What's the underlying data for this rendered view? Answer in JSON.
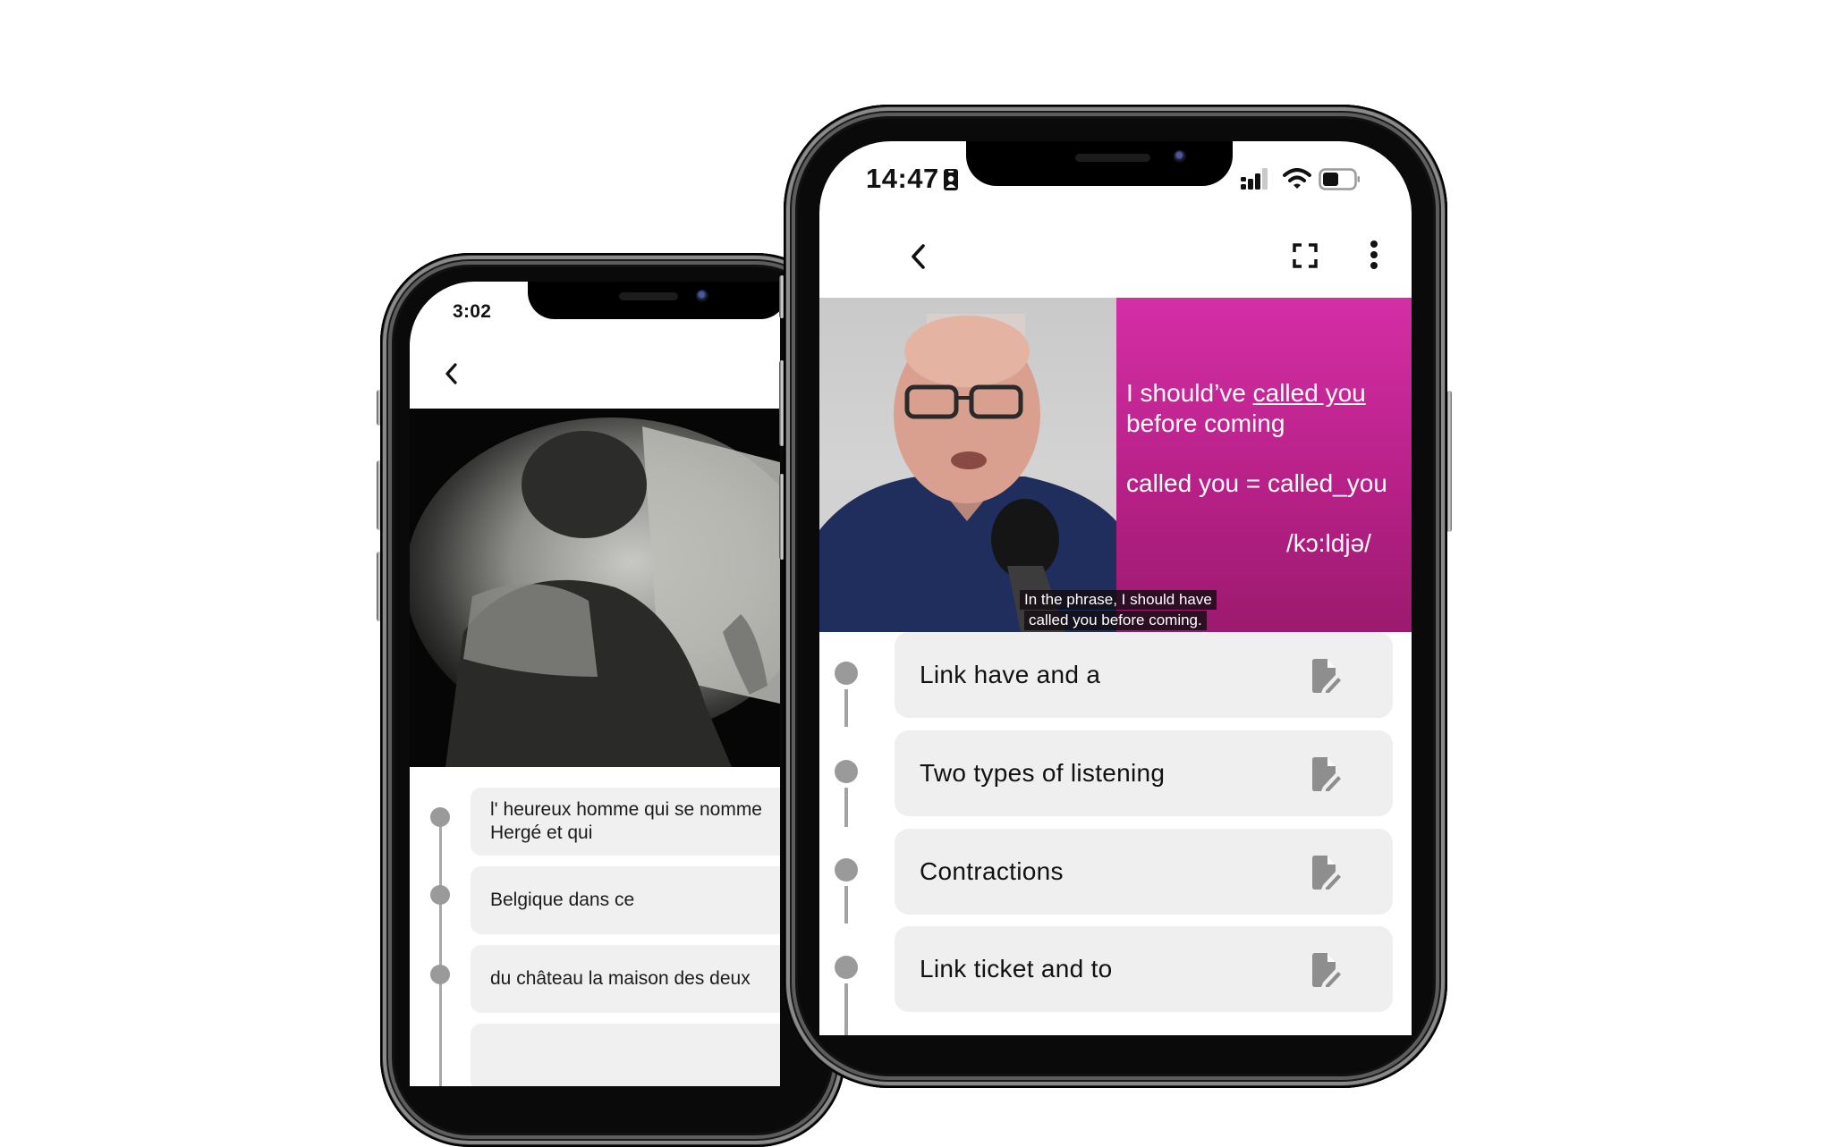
{
  "left_phone": {
    "status_bar": {
      "time": "3:02"
    },
    "nav": {
      "back_icon": "chevron-left-icon"
    },
    "video": {
      "description": "black-and-white film of a man drawing at a desk"
    },
    "timeline": [
      {
        "text": "l' heureux homme qui se nomme Hergé et qui"
      },
      {
        "text": "Belgique dans ce"
      },
      {
        "text": "du château la maison des deux"
      },
      {
        "text": ""
      }
    ],
    "colors": {
      "card_bg": "#f0f0f0",
      "dot": "#9a9a9a"
    }
  },
  "right_phone": {
    "status_bar": {
      "time": "14:47",
      "badge_icon": "person-badge-icon",
      "signal_icon": "cellular-signal-icon",
      "wifi_icon": "wifi-icon",
      "battery_icon": "battery-icon",
      "battery_level": 0.45
    },
    "nav": {
      "back_icon": "chevron-left-icon",
      "fullscreen_icon": "fullscreen-icon",
      "more_icon": "more-vertical-icon"
    },
    "video": {
      "slide": {
        "line1_prefix": "I should’ve ",
        "line1_underlined": "called you",
        "line2": "before coming",
        "line3": "called you = called_you",
        "line4": "/kɔ:ldjə/"
      },
      "caption": {
        "line1": "In the phrase, I should have",
        "line2": "called you before coming."
      }
    },
    "timeline": [
      {
        "label": "Link have and a",
        "icon": "edit-note-icon"
      },
      {
        "label": "Two types of listening",
        "icon": "edit-note-icon"
      },
      {
        "label": "Contractions",
        "icon": "edit-note-icon"
      },
      {
        "label": "Link ticket and to",
        "icon": "edit-note-icon"
      }
    ],
    "colors": {
      "slide_top": "#d42ea5",
      "slide_bottom": "#9c1a6e",
      "card_bg": "#efefef",
      "icon": "#8e8e8e"
    }
  }
}
